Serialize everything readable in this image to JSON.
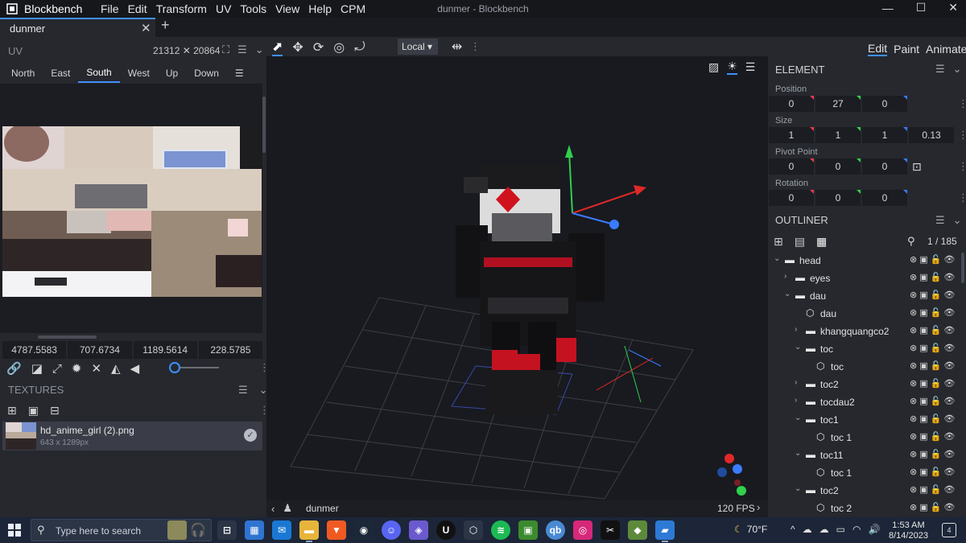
{
  "app": {
    "name": "Blockbench",
    "window_title": "dunmer - Blockbench",
    "menu": [
      "File",
      "Edit",
      "Transform",
      "UV",
      "Tools",
      "View",
      "Help",
      "CPM"
    ]
  },
  "tab": {
    "label": "dunmer"
  },
  "uv_panel": {
    "title": "UV",
    "size": "21312 ✕ 20864",
    "faces": [
      "North",
      "East",
      "South",
      "West",
      "Up",
      "Down"
    ],
    "active_face": "South",
    "values": [
      "4787.5583",
      "707.6734",
      "1189.5614",
      "228.5785"
    ]
  },
  "textures": {
    "title": "TEXTURES",
    "items": [
      {
        "name": "hd_anime_girl (2).png",
        "dimensions": "643 x 1289px"
      }
    ]
  },
  "toolbar": {
    "space": "Local"
  },
  "modes": [
    "Edit",
    "Paint",
    "Animate"
  ],
  "active_mode": "Edit",
  "element": {
    "title": "ELEMENT",
    "position_label": "Position",
    "position": [
      "0",
      "27",
      "0"
    ],
    "size_label": "Size",
    "size": [
      "1",
      "1",
      "1",
      "0.13"
    ],
    "pivot_label": "Pivot Point",
    "pivot": [
      "0",
      "0",
      "0"
    ],
    "rotation_label": "Rotation",
    "rotation": [
      "0",
      "0",
      "0"
    ]
  },
  "outliner": {
    "title": "OUTLINER",
    "count": "1 / 185",
    "nodes": [
      {
        "name": "head",
        "type": "group",
        "depth": 0,
        "expanded": true
      },
      {
        "name": "eyes",
        "type": "group",
        "depth": 1,
        "expanded": false
      },
      {
        "name": "dau",
        "type": "group",
        "depth": 1,
        "expanded": true
      },
      {
        "name": "dau",
        "type": "cube",
        "depth": 2
      },
      {
        "name": "khangquangco2",
        "type": "group",
        "depth": 2,
        "expanded": false
      },
      {
        "name": "toc",
        "type": "group",
        "depth": 2,
        "expanded": true
      },
      {
        "name": "toc",
        "type": "cube",
        "depth": 3
      },
      {
        "name": "toc2",
        "type": "group",
        "depth": 2,
        "expanded": false
      },
      {
        "name": "tocdau2",
        "type": "group",
        "depth": 2,
        "expanded": false
      },
      {
        "name": "toc1",
        "type": "group",
        "depth": 2,
        "expanded": true
      },
      {
        "name": "toc 1",
        "type": "cube",
        "depth": 3
      },
      {
        "name": "toc11",
        "type": "group",
        "depth": 2,
        "expanded": true
      },
      {
        "name": "toc 1",
        "type": "cube",
        "depth": 3
      },
      {
        "name": "toc2",
        "type": "group",
        "depth": 2,
        "expanded": true
      },
      {
        "name": "toc 2",
        "type": "cube",
        "depth": 3
      }
    ]
  },
  "viewport": {
    "model_name": "dunmer",
    "fps": "120 FPS"
  },
  "taskbar": {
    "search_placeholder": "Type here to search",
    "weather": "70°F",
    "time": "1:53 AM",
    "date": "8/14/2023",
    "notifications": "4"
  }
}
